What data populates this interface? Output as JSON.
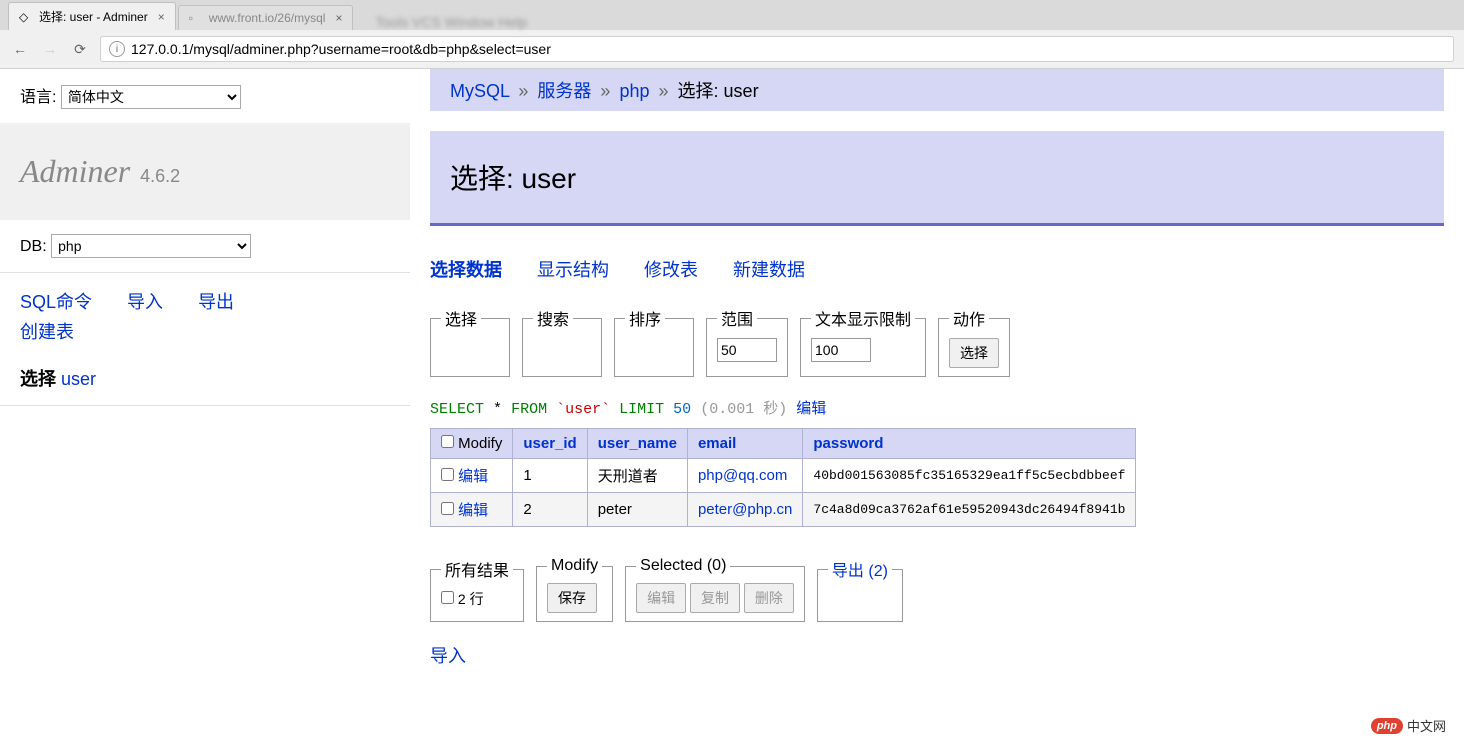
{
  "browser": {
    "tabs": [
      {
        "title": "选择: user - Adminer",
        "close": "×"
      },
      {
        "title": "www.front.io/26/mysql",
        "close": "×"
      }
    ],
    "blur_menu": "Tools VCS Window Help",
    "url": "127.0.0.1/mysql/adminer.php?username=root&db=php&select=user",
    "info_icon": "ⓘ"
  },
  "sidebar": {
    "lang_label": "语言:",
    "lang_value": "简体中文",
    "logo_name": "Adminer",
    "logo_version": "4.6.2",
    "db_label": "DB:",
    "db_value": "php",
    "links": {
      "sql": "SQL命令",
      "import": "导入",
      "export": "导出",
      "create": "创建表"
    },
    "select_label": "选择",
    "select_table": "user"
  },
  "breadcrumb": {
    "mysql": "MySQL",
    "server": "服务器",
    "db": "php",
    "select_prefix": "选择",
    "table": "user",
    "sep": "»"
  },
  "title": "选择: user",
  "tabs": {
    "select": "选择数据",
    "structure": "显示结构",
    "alter": "修改表",
    "new": "新建数据"
  },
  "fieldsets": {
    "select": "选择",
    "search": "搜索",
    "sort": "排序",
    "limit_label": "范围",
    "limit_value": "50",
    "text_label": "文本显示限制",
    "text_value": "100",
    "action_label": "动作",
    "action_btn": "选择"
  },
  "sql": {
    "select": "SELECT",
    "star": "*",
    "from": "FROM",
    "table": "`user`",
    "limit": "LIMIT",
    "num": "50",
    "time": "(0.001 秒)",
    "edit": "编辑"
  },
  "table": {
    "headers": {
      "modify": "Modify",
      "user_id": "user_id",
      "user_name": "user_name",
      "email": "email",
      "password": "password"
    },
    "edit_label": "编辑",
    "rows": [
      {
        "user_id": "1",
        "user_name": "天刑道者",
        "email": "php@qq.com",
        "password": "40bd001563085fc35165329ea1ff5c5ecbdbbeef"
      },
      {
        "user_id": "2",
        "user_name": "peter",
        "email": "peter@php.cn",
        "password": "7c4a8d09ca3762af61e59520943dc26494f8941b"
      }
    ]
  },
  "footer": {
    "all_results": "所有结果",
    "row_count": "2 行",
    "modify": "Modify",
    "save": "保存",
    "selected": "Selected (0)",
    "edit": "编辑",
    "copy": "复制",
    "delete": "删除",
    "export": "导出 (2)",
    "import": "导入"
  },
  "watermark": {
    "badge": "php",
    "text": "中文网"
  }
}
